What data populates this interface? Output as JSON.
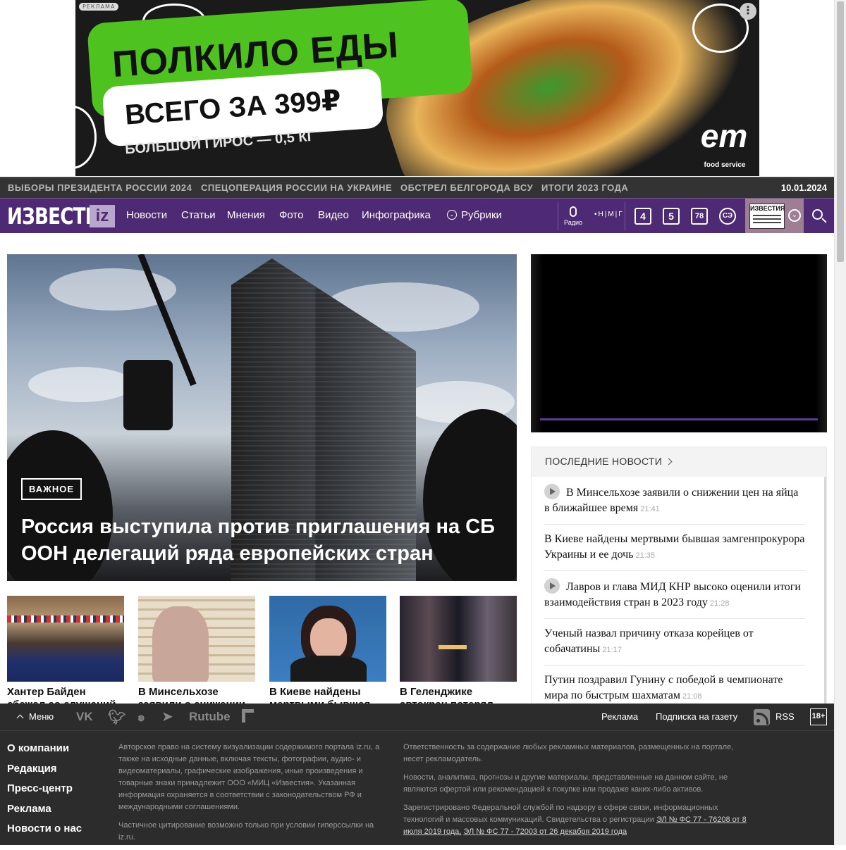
{
  "ad": {
    "tag": "РЕКЛАМА",
    "headline": "ПОЛКИЛО ЕДЫ",
    "price": "ВСЕГО ЗА 399₽",
    "sub": "БОЛЬШОЙ ГИРОС — 0,5 КГ",
    "logo": "em",
    "logo_sub": "food service",
    "menu": "⋮"
  },
  "topics": {
    "items": [
      "ВЫБОРЫ ПРЕЗИДЕНТА РОССИИ 2024",
      "СПЕЦОПЕРАЦИЯ РОССИИ НА УКРАИНЕ",
      "ОБСТРЕЛ БЕЛГОРОДА ВСУ",
      "ИТОГИ 2023 ГОДА"
    ],
    "date": "10.01.2024"
  },
  "nav": {
    "brand": "ИЗВЕСТИЯ",
    "brand_badge": "iz",
    "items": [
      "Новости",
      "Статьи",
      "Мнения",
      "Фото",
      "Видео",
      "Инфографика",
      "Рубрики"
    ],
    "radio": "Радио",
    "mmr": "•Н|М|Г",
    "channels": [
      "4",
      "5",
      "78",
      "СЭ"
    ],
    "paper": "ИЗВЕСТИЯ",
    "chevron": "⌄"
  },
  "hero": {
    "badge": "ВАЖНОЕ",
    "title": "Россия выступила против приглашения на СБ ООН делегаций ряда европейских стран"
  },
  "latest": {
    "title": "ПОСЛЕДНИЕ НОВОСТИ",
    "items": [
      {
        "text": "В Минсельхозе заявили о снижении цен на яйца в ближайшее время",
        "time": "21:41",
        "video": true
      },
      {
        "text": "В Киеве найдены мертвыми бывшая замгенпрокурора Украины и ее дочь",
        "time": "21:35",
        "video": false
      },
      {
        "text": "Лавров и глава МИД КНР высоко оценили итоги взаимодействия стран в 2023 году",
        "time": "21:28",
        "video": true
      },
      {
        "text": "Ученый назвал причину отказа корейцев от собачатины",
        "time": "21:17",
        "video": false
      },
      {
        "text": "Путин поздравил Гунину с победой в чемпионате мира по быстрым шахматам",
        "time": "21:08",
        "video": false
      }
    ]
  },
  "cards": [
    {
      "title": "Хантер Байден сбежал со слушаний в"
    },
    {
      "title": "В Минсельхозе заявили о снижении"
    },
    {
      "title": "В Киеве найдены мертвыми бывшая"
    },
    {
      "title": "В Геленджике автокран потерял"
    }
  ],
  "footer": {
    "menu": "Меню",
    "social": [
      "VK",
      "Twitter",
      "OK",
      "Telegram",
      "Rutube",
      "Dzen"
    ],
    "social_labels": {
      "vk": "VK",
      "rutube": "Rutube"
    },
    "links": {
      "ads": "Реклама",
      "subscribe": "Подписка на газету",
      "rss": "RSS",
      "age": "18+"
    },
    "nav": [
      "О компании",
      "Редакция",
      "Пресс-центр",
      "Реклама",
      "Новости о нас"
    ],
    "col1": [
      "Авторское право на систему визуализации содержимого портала iz.ru, а также на исходные данные, включая тексты, фотографии, аудио- и видеоматериалы, графические изображения, иные произведения и товарные знаки принадлежит ООО «МИЦ «Известия». Указанная информация охраняется в соответствии с законодательством РФ и международными соглашениями.",
      "Частичное цитирование возможно только при условии гиперссылки на iz.ru."
    ],
    "col2": [
      "Ответственность за содержание любых рекламных материалов, размещенных на портале, несет рекламодатель.",
      "Новости, аналитика, прогнозы и другие материалы, представленные на данном сайте, не являются офертой или рекомендацией к покупке или продаже каких-либо активов.",
      "Зарегистрировано Федеральной службой по надзору в сфере связи, информационных технологий и массовых коммуникаций. Свидетельства о регистрации"
    ],
    "reg1": "ЭЛ № ФС 77 - 76208 от 8 июля 2019 года,",
    "reg2": "ЭЛ № ФС 77 - 72003 от 26 декабря 2019 года"
  }
}
